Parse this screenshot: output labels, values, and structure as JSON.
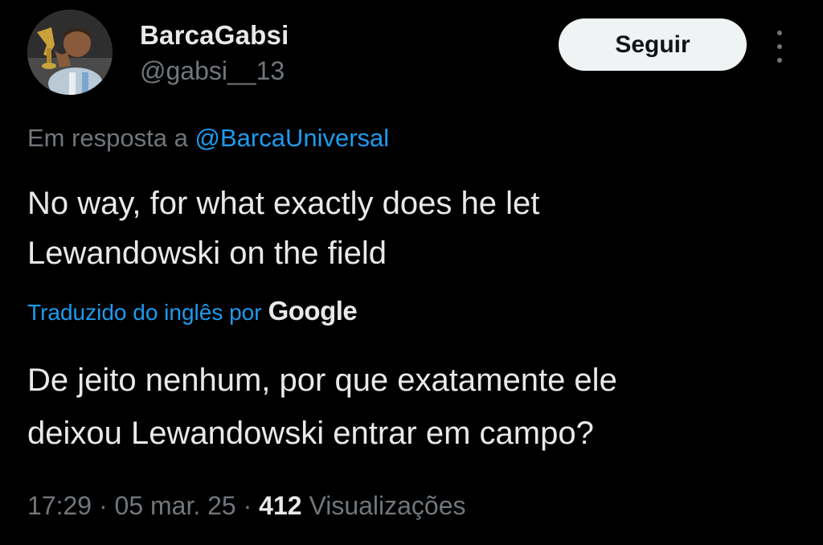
{
  "author": {
    "display_name": "BarcaGabsi",
    "handle": "@gabsi__13",
    "avatar_icon": "user-avatar-photo"
  },
  "actions": {
    "follow_label": "Seguir",
    "more_icon": "more-vertical-icon"
  },
  "reply": {
    "prefix": "Em resposta a",
    "mention": "@BarcaUniversal"
  },
  "tweet": {
    "text_line1": "No way, for what exactly does he let",
    "text_line2": "Lewandowski on the field"
  },
  "translation": {
    "label": "Traduzido do inglês por",
    "provider": "Google",
    "text_line1": "De jeito nenhum, por que exatamente ele",
    "text_line2": "deixou Lewandowski entrar em campo?"
  },
  "meta": {
    "time": "17:29",
    "separator": "·",
    "date": "05 mar. 25",
    "views_count": "412",
    "views_label": "Visualizações"
  },
  "colors": {
    "background": "#000000",
    "primary_text": "#e7e9ea",
    "secondary_text": "#71767b",
    "link": "#1d9bf0",
    "button_bg": "#eff3f4"
  }
}
